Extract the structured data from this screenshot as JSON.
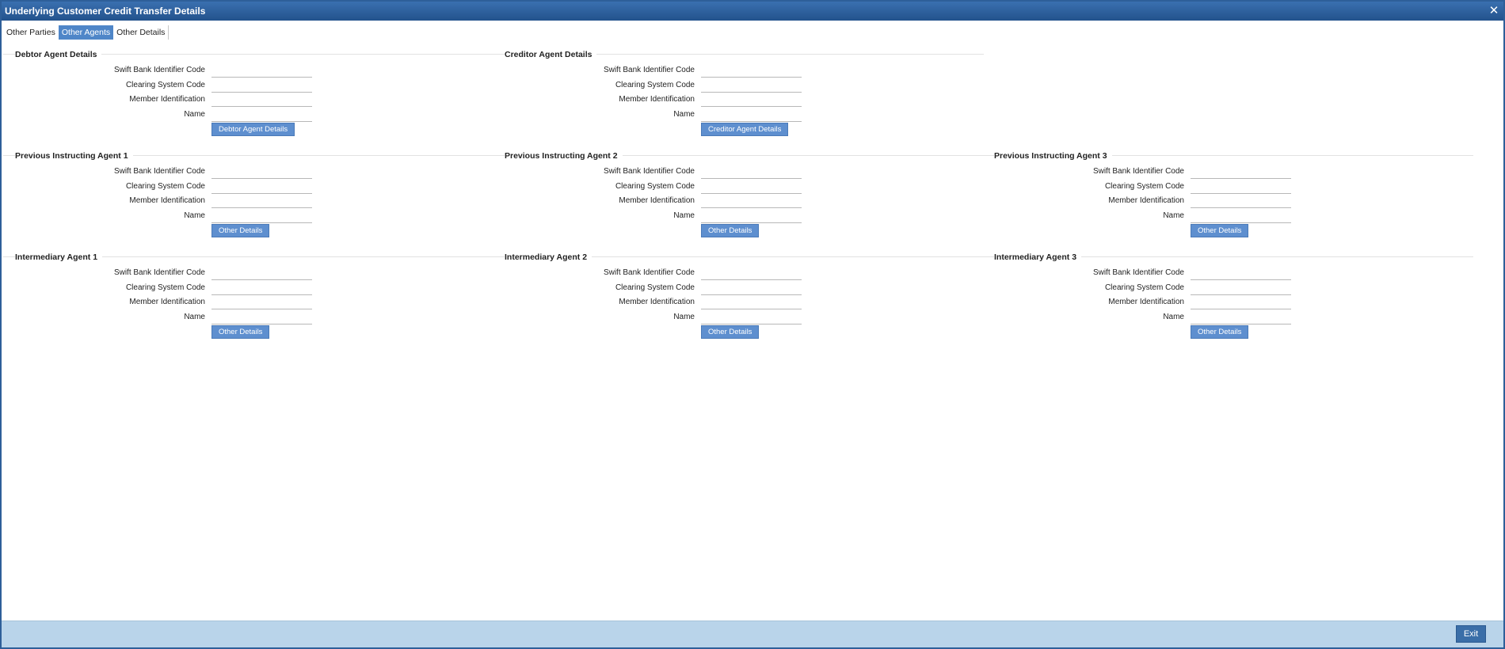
{
  "window": {
    "title": "Underlying Customer Credit Transfer Details",
    "close_symbol": "✕"
  },
  "tabs": [
    {
      "label": "Other Parties",
      "active": false
    },
    {
      "label": "Other Agents",
      "active": true
    },
    {
      "label": "Other Details",
      "active": false
    }
  ],
  "field_labels": {
    "bic": "Swift Bank Identifier Code",
    "clearing": "Clearing System Code",
    "member": "Member Identification",
    "name": "Name"
  },
  "sections": {
    "debtor_agent": {
      "title": "Debtor Agent Details",
      "button": "Debtor Agent Details",
      "values": {
        "bic": "",
        "clearing": "",
        "member": "",
        "name": ""
      }
    },
    "creditor_agent": {
      "title": "Creditor Agent Details",
      "button": "Creditor Agent Details",
      "values": {
        "bic": "",
        "clearing": "",
        "member": "",
        "name": ""
      }
    },
    "prev_instructing_1": {
      "title": "Previous Instructing Agent 1",
      "button": "Other Details",
      "values": {
        "bic": "",
        "clearing": "",
        "member": "",
        "name": ""
      }
    },
    "prev_instructing_2": {
      "title": "Previous Instructing Agent 2",
      "button": "Other Details",
      "values": {
        "bic": "",
        "clearing": "",
        "member": "",
        "name": ""
      }
    },
    "prev_instructing_3": {
      "title": "Previous Instructing Agent 3",
      "button": "Other Details",
      "values": {
        "bic": "",
        "clearing": "",
        "member": "",
        "name": ""
      }
    },
    "intermediary_1": {
      "title": "Intermediary Agent 1",
      "button": "Other Details",
      "values": {
        "bic": "",
        "clearing": "",
        "member": "",
        "name": ""
      }
    },
    "intermediary_2": {
      "title": "Intermediary Agent 2",
      "button": "Other Details",
      "values": {
        "bic": "",
        "clearing": "",
        "member": "",
        "name": ""
      }
    },
    "intermediary_3": {
      "title": "Intermediary Agent 3",
      "button": "Other Details",
      "values": {
        "bic": "",
        "clearing": "",
        "member": "",
        "name": ""
      }
    }
  },
  "footer": {
    "exit_label": "Exit"
  },
  "colors": {
    "titlebar": "#2d5f9c",
    "active_tab": "#4f86c8",
    "button": "#5e8fcf",
    "footer": "#b9d4ea"
  }
}
